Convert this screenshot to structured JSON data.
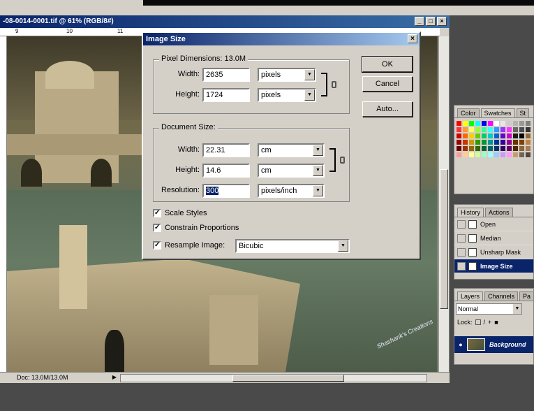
{
  "document": {
    "title": "-08-0014-0001.tif @ 61% (RGB/8#)",
    "window_buttons": [
      "_",
      "□",
      "×"
    ],
    "ruler_ticks": [
      "9",
      "10",
      "11"
    ],
    "status_text": "Doc: 13.0M/13.0M",
    "status_arrow": "▶",
    "watermark": "Shashank's Creations"
  },
  "dialog": {
    "title": "Image Size",
    "close_label": "×",
    "pixel_dimensions": {
      "label": "Pixel Dimensions:  13.0M",
      "width_label": "Width:",
      "width_value": "2635",
      "width_unit": "pixels",
      "height_label": "Height:",
      "height_value": "1724",
      "height_unit": "pixels"
    },
    "document_size": {
      "label": "Document Size:",
      "width_label": "Width:",
      "width_value": "22.31",
      "width_unit": "cm",
      "height_label": "Height:",
      "height_value": "14.6",
      "height_unit": "cm",
      "resolution_label": "Resolution:",
      "resolution_value": "300",
      "resolution_unit": "pixels/inch"
    },
    "options": {
      "scale_styles": "Scale Styles",
      "constrain_proportions": "Constrain Proportions",
      "resample_image": "Resample Image:",
      "resample_method": "Bicubic",
      "check_mark": "✓"
    },
    "buttons": {
      "ok": "OK",
      "cancel": "Cancel",
      "auto": "Auto..."
    }
  },
  "panels": {
    "swatches": {
      "tabs": [
        "Color",
        "Swatches",
        "St"
      ],
      "colors": [
        "#ff0000",
        "#ffff00",
        "#00ff00",
        "#00ffff",
        "#0000ff",
        "#ff00ff",
        "#ffffff",
        "#e6e6e6",
        "#cccccc",
        "#b3b3b3",
        "#999999",
        "#808080",
        "#ff3333",
        "#ff9933",
        "#ffff66",
        "#99ff33",
        "#33ff99",
        "#33ffff",
        "#3399ff",
        "#9933ff",
        "#ff33ff",
        "#666666",
        "#4d4d4d",
        "#333333",
        "#cc0000",
        "#ff6600",
        "#ffcc00",
        "#66cc00",
        "#00cc66",
        "#00cccc",
        "#0066cc",
        "#6600cc",
        "#cc00cc",
        "#1a1a1a",
        "#000000",
        "#996633",
        "#990000",
        "#cc3300",
        "#cc9900",
        "#339900",
        "#009933",
        "#009999",
        "#003399",
        "#330099",
        "#990099",
        "#663300",
        "#804000",
        "#c08040",
        "#660000",
        "#993300",
        "#996600",
        "#336600",
        "#006633",
        "#006666",
        "#003366",
        "#330066",
        "#660066",
        "#4d2600",
        "#8c6239",
        "#a67c52",
        "#ff9999",
        "#ffcc99",
        "#ffff99",
        "#ccff99",
        "#99ffcc",
        "#99ffff",
        "#99ccff",
        "#cc99ff",
        "#ff99ff",
        "#c69c6d",
        "#736357",
        "#534741"
      ]
    },
    "history": {
      "tabs": [
        "History",
        "Actions"
      ],
      "items": [
        {
          "label": "Open",
          "selected": false
        },
        {
          "label": "Median",
          "selected": false
        },
        {
          "label": "Unsharp Mask",
          "selected": false
        },
        {
          "label": "Image Size",
          "selected": true
        }
      ]
    },
    "layers": {
      "tabs": [
        "Layers",
        "Channels",
        "Pa"
      ],
      "blend_mode": "Normal",
      "lock_label": "Lock:",
      "layer_name": "Background",
      "eye": "●"
    }
  }
}
